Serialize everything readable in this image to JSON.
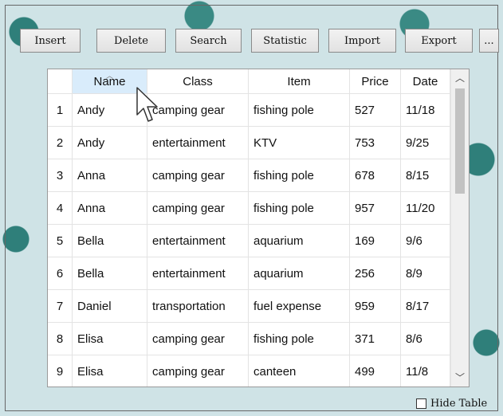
{
  "toolbar": {
    "buttons": [
      "Insert",
      "Delete",
      "Search",
      "Statistic",
      "Import",
      "Export",
      "..."
    ]
  },
  "table": {
    "columns": [
      "Name",
      "Class",
      "Item",
      "Price",
      "Date"
    ],
    "sorted_column": "Name",
    "rows": [
      {
        "idx": "1",
        "name": "Andy",
        "class": "camping gear",
        "item": "fishing pole",
        "price": "527",
        "date": "11/18"
      },
      {
        "idx": "2",
        "name": "Andy",
        "class": "entertainment",
        "item": "KTV",
        "price": "753",
        "date": "9/25"
      },
      {
        "idx": "3",
        "name": "Anna",
        "class": "camping gear",
        "item": "fishing pole",
        "price": "678",
        "date": "8/15"
      },
      {
        "idx": "4",
        "name": "Anna",
        "class": "camping gear",
        "item": "fishing pole",
        "price": "957",
        "date": "11/20"
      },
      {
        "idx": "5",
        "name": "Bella",
        "class": "entertainment",
        "item": "aquarium",
        "price": "169",
        "date": "9/6"
      },
      {
        "idx": "6",
        "name": "Bella",
        "class": "entertainment",
        "item": "aquarium",
        "price": "256",
        "date": "8/9"
      },
      {
        "idx": "7",
        "name": "Daniel",
        "class": "transportation",
        "item": "fuel expense",
        "price": "959",
        "date": "8/17"
      },
      {
        "idx": "8",
        "name": "Elisa",
        "class": "camping gear",
        "item": "fishing pole",
        "price": "371",
        "date": "8/6"
      },
      {
        "idx": "9",
        "name": "Elisa",
        "class": "camping gear",
        "item": "canteen",
        "price": "499",
        "date": "11/8"
      }
    ]
  },
  "hide_table": {
    "label": "Hide Table",
    "checked": false
  },
  "icons": {
    "sort": "sort-ascending-icon",
    "scroll_up": "chevron-up-icon",
    "scroll_down": "chevron-down-icon",
    "cursor": "mouse-pointer-icon"
  },
  "colors": {
    "header_selected": "#d9ecfb",
    "scroll_thumb": "#c2c2c2"
  }
}
